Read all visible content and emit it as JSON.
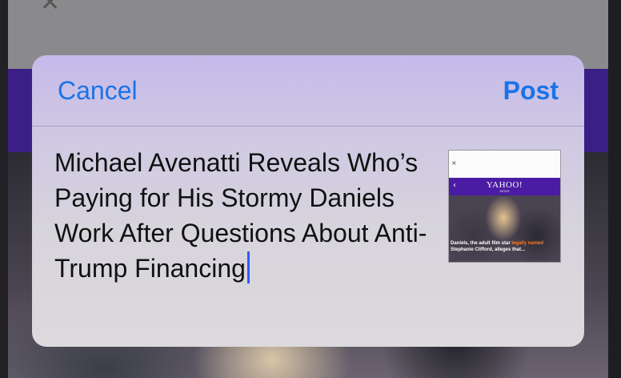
{
  "background": {
    "close_icon": "close-icon",
    "close_glyph": "✕",
    "band_color": "#3b1f86"
  },
  "share_sheet": {
    "cancel_label": "Cancel",
    "post_label": "Post",
    "compose_text": "Michael Avenatti Reveals Who’s Paying for His Stormy Daniels Work After Questions About Anti-Trump Financing",
    "accent_color": "#1a73e8",
    "caret_color": "#2f5bff"
  },
  "thumbnail": {
    "close_glyph": "×",
    "back_glyph": "‹",
    "logo": "YAHOO!",
    "logo_sub": "NEWS",
    "caption_part1": "Daniels, the adult film star ",
    "caption_highlight": "legally named",
    "caption_part2": " Stephanie Clifford",
    "caption_part3": ", alleges that...",
    "brand_color": "#4b1ca3"
  }
}
